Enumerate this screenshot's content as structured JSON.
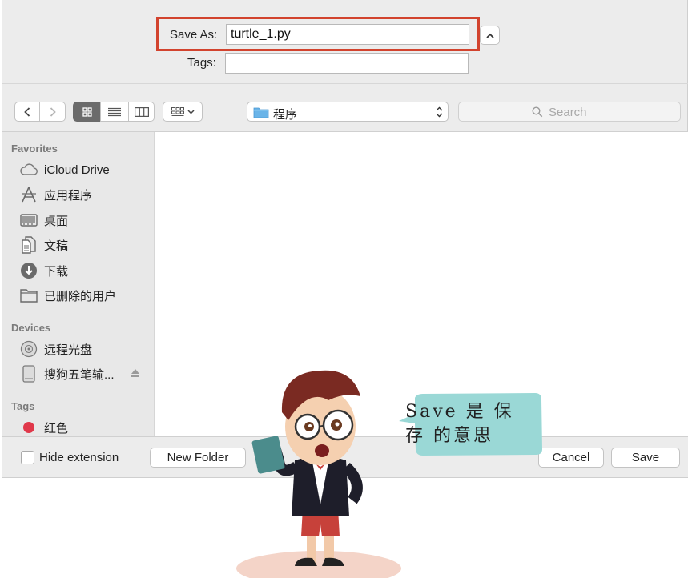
{
  "save_as": {
    "label": "Save As:",
    "value": "turtle_1.py"
  },
  "tags": {
    "label": "Tags:",
    "value": ""
  },
  "toolbar": {
    "location": "程序",
    "search_placeholder": "Search"
  },
  "sidebar": {
    "favorites_title": "Favorites",
    "favorites": [
      {
        "label": "iCloud Drive",
        "icon": "cloud-icon"
      },
      {
        "label": "应用程序",
        "icon": "applications-icon"
      },
      {
        "label": "桌面",
        "icon": "desktop-icon"
      },
      {
        "label": "文稿",
        "icon": "documents-icon"
      },
      {
        "label": "下载",
        "icon": "download-icon"
      },
      {
        "label": "已删除的用户",
        "icon": "folder-icon"
      }
    ],
    "devices_title": "Devices",
    "devices": [
      {
        "label": "远程光盘",
        "icon": "disc-icon"
      },
      {
        "label": "搜狗五笔输...",
        "icon": "drive-icon"
      }
    ],
    "tags_title": "Tags",
    "tags": [
      {
        "label": "红色",
        "color": "#e0384a"
      }
    ]
  },
  "bottom": {
    "hide_extension": "Hide extension",
    "new_folder": "New Folder",
    "cancel": "Cancel",
    "save": "Save"
  },
  "bubble": {
    "text": "Save 是 保 存 的意思",
    "color": "#9ad8d6"
  },
  "colors": {
    "highlight_border": "#d2432e"
  }
}
